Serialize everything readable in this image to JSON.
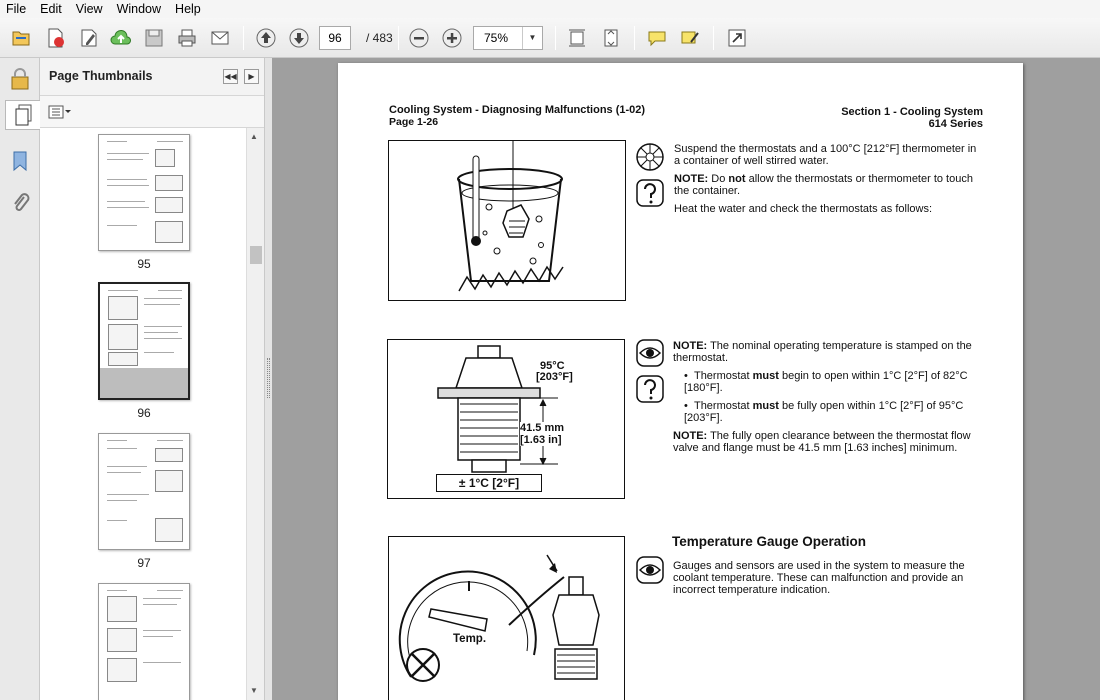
{
  "menu": [
    "File",
    "Edit",
    "View",
    "Window",
    "Help"
  ],
  "toolbar": {
    "page_current": "96",
    "page_total": "/ 483",
    "zoom": "75%"
  },
  "panel": {
    "title": "Page Thumbnails",
    "thumbs": [
      {
        "label": "95"
      },
      {
        "label": "96"
      },
      {
        "label": "97"
      }
    ]
  },
  "doc": {
    "header_left": "Cooling System - Diagnosing Malfunctions (1-02)",
    "header_left_page": "Page 1-26",
    "header_right": "Section 1 - Cooling System",
    "header_right_series": "614 Series",
    "block1_p1": "Suspend the thermostats and a 100°C [212°F] thermometer in a container of well stirred water.",
    "block1_note_label": "NOTE:",
    "block1_note_a": "Do ",
    "block1_note_bold": "not",
    "block1_note_b": " allow the thermostats or thermometer to touch the container.",
    "block1_p2": "Heat the water and check the thermostats as follows:",
    "fig2_temp": "95°C",
    "fig2_temp_f": "[203°F]",
    "fig2_mm": "41.5 mm",
    "fig2_in": "[1.63 in]",
    "fig2_tol": "± 1°C [2°F]",
    "block2_note_label": "NOTE:",
    "block2_note": " The nominal operating temperature is stamped on the thermostat.",
    "bullet1_a": "Thermostat ",
    "bullet1_bold": "must",
    "bullet1_b": " begin to open within 1°C [2°F] of 82°C [180°F].",
    "bullet2_a": "Thermostat ",
    "bullet2_bold": "must",
    "bullet2_b": " be fully open within 1°C [2°F] of 95°C [203°F].",
    "block2_note2_label": "NOTE:",
    "block2_note2": " The fully open clearance between the thermostat flow valve and flange must be 41.5 mm [1.63 inches] minimum.",
    "section_heading": "Temperature Gauge Operation",
    "section_text": "Gauges and sensors are used in the system to measure the coolant temperature. These can malfunction and provide an incorrect temperature indication.",
    "fig3_label": "Temp."
  }
}
